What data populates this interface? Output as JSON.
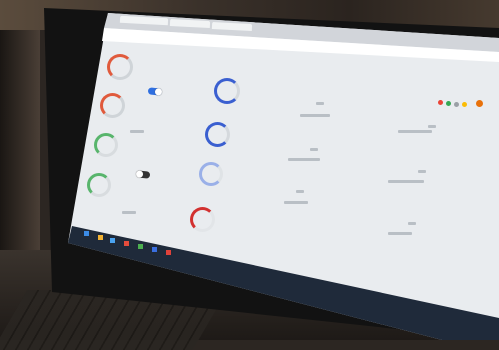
{
  "browser": {
    "tabs": [
      {
        "title": ""
      },
      {
        "title": ""
      },
      {
        "title": ""
      }
    ],
    "url": ""
  },
  "dashboard": {
    "left_gauges": [
      {
        "color": "#e05a3c"
      },
      {
        "color": "#e05a3c"
      },
      {
        "color": "#58b56c"
      },
      {
        "color": "#58b56c"
      }
    ],
    "toggles": [
      {
        "state": "on",
        "color": "#2f6fe0"
      },
      {
        "state": "off",
        "color": "#333333"
      }
    ],
    "accent_colors": {
      "blue": "#3a5fd0",
      "red": "#d2302f"
    }
  },
  "device": {
    "brand": ""
  }
}
